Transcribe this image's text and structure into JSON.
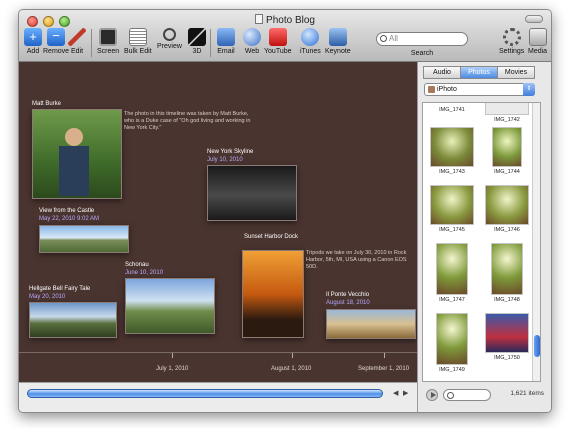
{
  "window": {
    "title": "Photo Blog"
  },
  "toolbar": {
    "add": "Add",
    "remove": "Remove",
    "edit": "Edit",
    "screen": "Screen",
    "bulk_edit": "Bulk Edit",
    "preview": "Preview",
    "three_d": "3D",
    "email": "Email",
    "web": "Web",
    "youtube": "YouTube",
    "itunes": "iTunes",
    "keynote": "Keynote",
    "search_placeholder": "All",
    "search_label": "Search",
    "settings": "Settings",
    "media": "Media"
  },
  "timeline": {
    "entries": [
      {
        "title": "Matt Burke",
        "date": ""
      },
      {
        "title": "View from the Castle",
        "date": "May 22, 2010 9:02 AM"
      },
      {
        "title": "Hellgate Bell Fairy Tale",
        "date": "May 20, 2010"
      },
      {
        "title": "Schonau",
        "date": "June 10, 2010"
      },
      {
        "title": "New York Skyline",
        "date": "July 10, 2010"
      },
      {
        "title": "Sunset Harbor Dock",
        "date": ""
      },
      {
        "title": "Il Ponte Vecchio",
        "date": "August 18, 2010"
      }
    ],
    "desc_matt": "The photo in this timeline was taken by Matt Burke, who is a Duke case of \"Oh god living and working in New York City.\"",
    "desc_sunset": "Tripods we take on July 30, 2010 in Rock Harbor, 5th, MI, USA using a Canon EOS 50D.",
    "axis_labels": [
      "July 1, 2010",
      "August 1, 2010",
      "September 1, 2010"
    ]
  },
  "panel": {
    "tabs": [
      "Audio",
      "Photos",
      "Movies"
    ],
    "source": "iPhoto",
    "items": [
      "IMG_1741",
      "IMG_1742",
      "IMG_1743",
      "IMG_1744",
      "IMG_1745",
      "IMG_1746",
      "IMG_1747",
      "IMG_1748",
      "IMG_1749",
      "IMG_1750"
    ],
    "count": "1,621 items"
  },
  "colors": {
    "timeline_bg": "#4a3430",
    "date_text": "#b9abff",
    "accent": "#4c8ae4"
  }
}
